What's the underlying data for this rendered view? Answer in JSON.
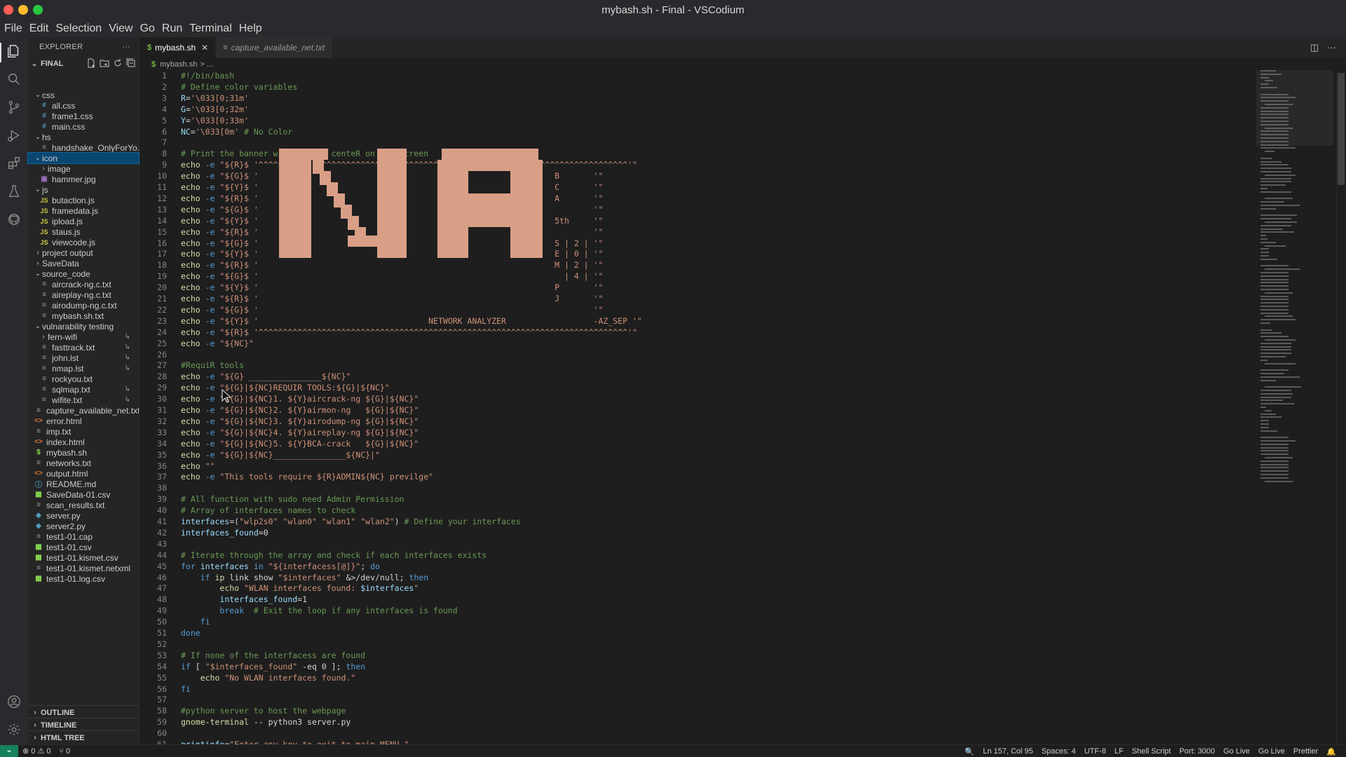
{
  "window": {
    "title": "mybash.sh - Final - VSCodium"
  },
  "menu": [
    "File",
    "Edit",
    "Selection",
    "View",
    "Go",
    "Run",
    "Terminal",
    "Help"
  ],
  "sidebar": {
    "title": "EXPLORER",
    "more": "···",
    "folder": "FINAL",
    "tree": [
      {
        "label": "css",
        "type": "folder",
        "open": true
      },
      {
        "label": "all.css",
        "type": "css"
      },
      {
        "label": "frame1.css",
        "type": "css"
      },
      {
        "label": "main.css",
        "type": "css"
      },
      {
        "label": "hs",
        "type": "folder",
        "open": true
      },
      {
        "label": "handshake_OnlyForYo...",
        "type": "txt"
      },
      {
        "label": "icon",
        "type": "folder",
        "open": true
      },
      {
        "label": "image",
        "type": "folder",
        "open": false
      },
      {
        "label": "hammer.jpg",
        "type": "img"
      },
      {
        "label": "js",
        "type": "folder",
        "open": true
      },
      {
        "label": "butaction.js",
        "type": "js"
      },
      {
        "label": "framedata.js",
        "type": "js"
      },
      {
        "label": "ipload.js",
        "type": "js"
      },
      {
        "label": "staus.js",
        "type": "js"
      },
      {
        "label": "viewcode.js",
        "type": "js"
      },
      {
        "label": "project output",
        "type": "folder",
        "open": false
      },
      {
        "label": "SaveData",
        "type": "folder",
        "open": false
      },
      {
        "label": "source_code",
        "type": "folder",
        "open": true
      },
      {
        "label": "aircrack-ng.c.txt",
        "type": "txt"
      },
      {
        "label": "aireplay-ng.c.txt",
        "type": "txt"
      },
      {
        "label": "airodump-ng.c.txt",
        "type": "txt"
      },
      {
        "label": "mybash.sh.txt",
        "type": "txt"
      },
      {
        "label": "vulnarability testing",
        "type": "folder",
        "open": true
      },
      {
        "label": "fern-wifi",
        "type": "folder",
        "open": false,
        "mark": "↳"
      },
      {
        "label": "fasttrack.txt",
        "type": "txt",
        "mark": "↳"
      },
      {
        "label": "john.lst",
        "type": "txt",
        "mark": "↳"
      },
      {
        "label": "nmap.lst",
        "type": "txt",
        "mark": "↳"
      },
      {
        "label": "rockyou.txt",
        "type": "txt"
      },
      {
        "label": "sqlmap.txt",
        "type": "txt",
        "mark": "↳"
      },
      {
        "label": "wifite.txt",
        "type": "txt",
        "mark": "↳"
      },
      {
        "label": "capture_available_net.txt",
        "type": "txt"
      },
      {
        "label": "error.html",
        "type": "html"
      },
      {
        "label": "imp.txt",
        "type": "txt"
      },
      {
        "label": "index.html",
        "type": "html"
      },
      {
        "label": "mybash.sh",
        "type": "sh"
      },
      {
        "label": "networks.txt",
        "type": "txt"
      },
      {
        "label": "output.html",
        "type": "html"
      },
      {
        "label": "README.md",
        "type": "md"
      },
      {
        "label": "SaveData-01.csv",
        "type": "csv"
      },
      {
        "label": "scan_results.txt",
        "type": "txt"
      },
      {
        "label": "server.py",
        "type": "py"
      },
      {
        "label": "server2.py",
        "type": "py"
      },
      {
        "label": "test1-01.cap",
        "type": "txt"
      },
      {
        "label": "test1-01.csv",
        "type": "csv"
      },
      {
        "label": "test1-01.kismet.csv",
        "type": "csv"
      },
      {
        "label": "test1-01.kismet.netxml",
        "type": "txt"
      },
      {
        "label": "test1-01.log.csv",
        "type": "csv"
      }
    ],
    "sections": [
      "OUTLINE",
      "TIMELINE",
      "HTML TREE"
    ]
  },
  "tabs": [
    {
      "label": "mybash.sh",
      "icon": "$",
      "active": true
    },
    {
      "label": "capture_available_net.txt",
      "icon": "≡",
      "active": false
    }
  ],
  "breadcrumb": {
    "icon": "$",
    "file": "mybash.sh",
    "rest": "> ..."
  },
  "editor": {
    "lines": [
      [
        [
          "c-comment",
          "#!/bin/bash"
        ]
      ],
      [
        [
          "c-comment",
          "# Define color variables"
        ]
      ],
      [
        [
          "c-var",
          "R"
        ],
        [
          "",
          "="
        ],
        [
          "c-str",
          "'\\033[0;31m'"
        ]
      ],
      [
        [
          "c-var",
          "G"
        ],
        [
          "",
          "="
        ],
        [
          "c-str",
          "'\\033[0;32m'"
        ]
      ],
      [
        [
          "c-var",
          "Y"
        ],
        [
          "",
          "="
        ],
        [
          "c-str",
          "'\\033[0;33m'"
        ]
      ],
      [
        [
          "c-var",
          "NC"
        ],
        [
          "",
          "="
        ],
        [
          "c-str",
          "'\\033[0m'"
        ],
        [
          "c-comment",
          " # No Color"
        ]
      ],
      [],
      [
        [
          "c-comment",
          "# Print the banner with colors centeR on the screen"
        ]
      ],
      [
        [
          "c-cmd",
          "echo"
        ],
        [
          "c-kw",
          " -e "
        ],
        [
          "c-str",
          "\"${R}$ '^^^^^^^^^^^^^^^^^^^^^^^^^^^^^^^^^^^^^^^^^^^^^^^^^^^^^^^^^^^^^^^^^^^^^^^^^^^^'\""
        ]
      ],
      [
        [
          "c-cmd",
          "echo"
        ],
        [
          "c-kw",
          " -e "
        ],
        [
          "c-str",
          "\"${G}$ '                                                             B       '\""
        ]
      ],
      [
        [
          "c-cmd",
          "echo"
        ],
        [
          "c-kw",
          " -e "
        ],
        [
          "c-str",
          "\"${Y}$ '                                                             C       '\""
        ]
      ],
      [
        [
          "c-cmd",
          "echo"
        ],
        [
          "c-kw",
          " -e "
        ],
        [
          "c-str",
          "\"${R}$ '                                                             A       '\""
        ]
      ],
      [
        [
          "c-cmd",
          "echo"
        ],
        [
          "c-kw",
          " -e "
        ],
        [
          "c-str",
          "\"${G}$ '                                                                     '\""
        ]
      ],
      [
        [
          "c-cmd",
          "echo"
        ],
        [
          "c-kw",
          " -e "
        ],
        [
          "c-str",
          "\"${Y}$ '                                                             5th     '\""
        ]
      ],
      [
        [
          "c-cmd",
          "echo"
        ],
        [
          "c-kw",
          " -e "
        ],
        [
          "c-str",
          "\"${R}$ '                                                                     '\""
        ]
      ],
      [
        [
          "c-cmd",
          "echo"
        ],
        [
          "c-kw",
          " -e "
        ],
        [
          "c-str",
          "\"${G}$ '                                                             S | 2 | '\""
        ]
      ],
      [
        [
          "c-cmd",
          "echo"
        ],
        [
          "c-kw",
          " -e "
        ],
        [
          "c-str",
          "\"${Y}$ '                                                             E | 0 | '\""
        ]
      ],
      [
        [
          "c-cmd",
          "echo"
        ],
        [
          "c-kw",
          " -e "
        ],
        [
          "c-str",
          "\"${R}$ '                                                             M | 2 | '\""
        ]
      ],
      [
        [
          "c-cmd",
          "echo"
        ],
        [
          "c-kw",
          " -e "
        ],
        [
          "c-str",
          "\"${G}$ '                                                               | 4 | '\""
        ]
      ],
      [
        [
          "c-cmd",
          "echo"
        ],
        [
          "c-kw",
          " -e "
        ],
        [
          "c-str",
          "\"${Y}$ '                                                             P       '\""
        ]
      ],
      [
        [
          "c-cmd",
          "echo"
        ],
        [
          "c-kw",
          " -e "
        ],
        [
          "c-str",
          "\"${R}$ '                                                             J       '\""
        ]
      ],
      [
        [
          "c-cmd",
          "echo"
        ],
        [
          "c-kw",
          " -e "
        ],
        [
          "c-str",
          "\"${G}$ '                                                                     '\""
        ]
      ],
      [
        [
          "c-cmd",
          "echo"
        ],
        [
          "c-kw",
          " -e "
        ],
        [
          "c-str",
          "\"${Y}$ '                                   NETWORK ANALYZER                  -AZ_SEP '\""
        ]
      ],
      [
        [
          "c-cmd",
          "echo"
        ],
        [
          "c-kw",
          " -e "
        ],
        [
          "c-str",
          "\"${R}$ '^^^^^^^^^^^^^^^^^^^^^^^^^^^^^^^^^^^^^^^^^^^^^^^^^^^^^^^^^^^^^^^^^^^^^^^^^^^^'\""
        ]
      ],
      [
        [
          "c-cmd",
          "echo"
        ],
        [
          "c-kw",
          " -e "
        ],
        [
          "c-str",
          "\"${NC}\""
        ]
      ],
      [],
      [
        [
          "c-comment",
          "#RequiR tools"
        ]
      ],
      [
        [
          "c-cmd",
          "echo"
        ],
        [
          "c-kw",
          " -e "
        ],
        [
          "c-str",
          "\"${G} _______________${NC}\""
        ]
      ],
      [
        [
          "c-cmd",
          "echo"
        ],
        [
          "c-kw",
          " -e "
        ],
        [
          "c-str",
          "\"${G}|${NC}REQUIR TOOLS:${G}|${NC}\""
        ]
      ],
      [
        [
          "c-cmd",
          "echo"
        ],
        [
          "c-kw",
          " -e "
        ],
        [
          "c-str",
          "\"${G}|${NC}1. ${Y}aircrack-ng ${G}|${NC}\""
        ]
      ],
      [
        [
          "c-cmd",
          "echo"
        ],
        [
          "c-kw",
          " -e "
        ],
        [
          "c-str",
          "\"${G}|${NC}2. ${Y}airmon-ng   ${G}|${NC}\""
        ]
      ],
      [
        [
          "c-cmd",
          "echo"
        ],
        [
          "c-kw",
          " -e "
        ],
        [
          "c-str",
          "\"${G}|${NC}3. ${Y}airodump-ng ${G}|${NC}\""
        ]
      ],
      [
        [
          "c-cmd",
          "echo"
        ],
        [
          "c-kw",
          " -e "
        ],
        [
          "c-str",
          "\"${G}|${NC}4. ${Y}aireplay-ng ${G}|${NC}\""
        ]
      ],
      [
        [
          "c-cmd",
          "echo"
        ],
        [
          "c-kw",
          " -e "
        ],
        [
          "c-str",
          "\"${G}|${NC}5. ${Y}BCA-crack   ${G}|${NC}\""
        ]
      ],
      [
        [
          "c-cmd",
          "echo"
        ],
        [
          "c-kw",
          " -e "
        ],
        [
          "c-str",
          "\"${G}|${NC}_______________${NC}|\""
        ]
      ],
      [
        [
          "c-cmd",
          "echo"
        ],
        [
          "c-str",
          " \"\""
        ]
      ],
      [
        [
          "c-cmd",
          "echo"
        ],
        [
          "c-kw",
          " -e "
        ],
        [
          "c-str",
          "\"This tools require ${R}ADMIN${NC} previlge\""
        ]
      ],
      [],
      [
        [
          "c-comment",
          "# All function with sudo need Admin Permission"
        ]
      ],
      [
        [
          "c-comment",
          "# Array of interfaces names to check"
        ]
      ],
      [
        [
          "c-var",
          "interfaces"
        ],
        [
          "",
          "=("
        ],
        [
          "c-str",
          "\"wlp2s0\" \"wlan0\" \"wlan1\" \"wlan2\""
        ],
        [
          "",
          ")"
        ],
        [
          "c-comment",
          " # Define your interfaces"
        ]
      ],
      [
        [
          "c-var",
          "interfaces_found"
        ],
        [
          "",
          "=0"
        ]
      ],
      [],
      [
        [
          "c-comment",
          "# Iterate through the array and check if each interfaces exists"
        ]
      ],
      [
        [
          "c-kw",
          "for "
        ],
        [
          "c-var",
          "interfaces"
        ],
        [
          "c-kw",
          " in "
        ],
        [
          "c-str",
          "\"${interfacess[@]}\""
        ],
        [
          "",
          "; "
        ],
        [
          "c-kw",
          "do"
        ]
      ],
      [
        [
          "",
          "    "
        ],
        [
          "c-kw",
          "if "
        ],
        [
          "c-cmd",
          "ip"
        ],
        [
          "",
          " link show "
        ],
        [
          "c-str",
          "\"$interfaces\""
        ],
        [
          "",
          " &>/dev/null; "
        ],
        [
          "c-kw",
          "then"
        ]
      ],
      [
        [
          "",
          "        "
        ],
        [
          "c-cmd",
          "echo"
        ],
        [
          "c-str",
          " \"WLAN interfaces found: "
        ],
        [
          "c-var",
          "$interfaces"
        ],
        [
          "c-str",
          "\""
        ]
      ],
      [
        [
          "",
          "        "
        ],
        [
          "c-var",
          "interfaces_found"
        ],
        [
          "",
          "=1"
        ]
      ],
      [
        [
          "",
          "        "
        ],
        [
          "c-kw",
          "break"
        ],
        [
          "c-comment",
          "  # Exit the loop if any interfaces is found"
        ]
      ],
      [
        [
          "",
          "    "
        ],
        [
          "c-kw",
          "fi"
        ]
      ],
      [
        [
          "c-kw",
          "done"
        ]
      ],
      [],
      [
        [
          "c-comment",
          "# If none of the interfacess are found"
        ]
      ],
      [
        [
          "c-kw",
          "if "
        ],
        [
          "",
          "[ "
        ],
        [
          "c-str",
          "\"$interfaces_found\""
        ],
        [
          "",
          " -eq 0 ]; "
        ],
        [
          "c-kw",
          "then"
        ]
      ],
      [
        [
          "",
          "    "
        ],
        [
          "c-cmd",
          "echo"
        ],
        [
          "c-str",
          " \"No WLAN interfaces found.\""
        ]
      ],
      [
        [
          "c-kw",
          "fi"
        ]
      ],
      [],
      [
        [
          "c-comment",
          "#python server to host the webpage"
        ]
      ],
      [
        [
          "c-cmd",
          "gnome-terminal"
        ],
        [
          "",
          " -- python3 server.py"
        ]
      ],
      [],
      [
        [
          "c-var",
          "printinfo"
        ],
        [
          "",
          "="
        ],
        [
          "c-str",
          "\"Enter any key to exit to main MENU \""
        ]
      ]
    ]
  },
  "statusbar": {
    "remote": "⌁",
    "problems": "⊗ 0 ⚠ 0",
    "ports": "⑂ 0",
    "zoom": "🔍",
    "position": "Ln 157, Col 95",
    "spaces": "Spaces: 4",
    "encoding": "UTF-8",
    "eol": "LF",
    "language": "Shell Script",
    "port": "Port: 3000",
    "golive1": "Go Live",
    "golive2": "Go Live",
    "prettier": "Prettier",
    "bell": "🔔"
  }
}
